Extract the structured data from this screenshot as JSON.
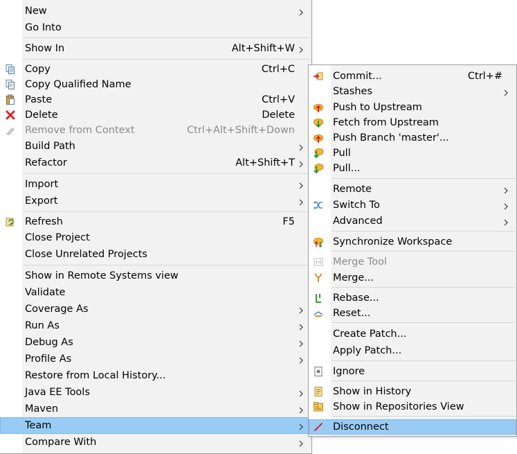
{
  "main_menu": {
    "items": [
      {
        "label": "New",
        "arrow": true
      },
      {
        "label": "Go Into"
      },
      {
        "label": "Show In",
        "shortcut": "Alt+Shift+W",
        "arrow": true
      },
      {
        "label": "Copy",
        "shortcut": "Ctrl+C",
        "icon": "copy-icon"
      },
      {
        "label": "Copy Qualified Name",
        "icon": "copy-qualified-name-icon"
      },
      {
        "label": "Paste",
        "shortcut": "Ctrl+V",
        "icon": "paste-icon"
      },
      {
        "label": "Delete",
        "shortcut": "Delete",
        "icon": "delete-icon"
      },
      {
        "label": "Remove from Context",
        "shortcut": "Ctrl+Alt+Shift+Down",
        "icon": "remove-from-context-icon",
        "disabled": true
      },
      {
        "label": "Build Path",
        "arrow": true
      },
      {
        "label": "Refactor",
        "shortcut": "Alt+Shift+T",
        "arrow": true
      },
      {
        "label": "Import",
        "arrow": true
      },
      {
        "label": "Export",
        "arrow": true
      },
      {
        "label": "Refresh",
        "shortcut": "F5",
        "icon": "refresh-icon"
      },
      {
        "label": "Close Project"
      },
      {
        "label": "Close Unrelated Projects"
      },
      {
        "label": "Show in Remote Systems view"
      },
      {
        "label": "Validate"
      },
      {
        "label": "Coverage As",
        "arrow": true
      },
      {
        "label": "Run As",
        "arrow": true
      },
      {
        "label": "Debug As",
        "arrow": true
      },
      {
        "label": "Profile As",
        "arrow": true
      },
      {
        "label": "Restore from Local History..."
      },
      {
        "label": "Java EE Tools",
        "arrow": true
      },
      {
        "label": "Maven",
        "arrow": true
      },
      {
        "label": "Team",
        "arrow": true,
        "highlighted": true
      },
      {
        "label": "Compare With",
        "arrow": true
      }
    ]
  },
  "team_menu": {
    "items": [
      {
        "label": "Commit...",
        "shortcut": "Ctrl+#",
        "icon": "commit-icon"
      },
      {
        "label": "Stashes",
        "arrow": true
      },
      {
        "label": "Push to Upstream",
        "icon": "push-upstream-icon"
      },
      {
        "label": "Fetch from Upstream",
        "icon": "fetch-upstream-icon"
      },
      {
        "label": "Push Branch 'master'...",
        "icon": "push-branch-icon"
      },
      {
        "label": "Pull",
        "icon": "pull-icon"
      },
      {
        "label": "Pull...",
        "icon": "pull-dialog-icon"
      },
      {
        "label": "Remote",
        "arrow": true
      },
      {
        "label": "Switch To",
        "arrow": true,
        "icon": "switch-branch-icon"
      },
      {
        "label": "Advanced",
        "arrow": true
      },
      {
        "label": "Synchronize Workspace",
        "icon": "synchronize-icon"
      },
      {
        "label": "Merge Tool",
        "icon": "merge-tool-icon",
        "disabled": true
      },
      {
        "label": "Merge...",
        "icon": "merge-icon"
      },
      {
        "label": "Rebase...",
        "icon": "rebase-icon"
      },
      {
        "label": "Reset...",
        "icon": "reset-icon"
      },
      {
        "label": "Create Patch..."
      },
      {
        "label": "Apply Patch..."
      },
      {
        "label": "Ignore",
        "icon": "ignore-icon"
      },
      {
        "label": "Show in History",
        "icon": "history-icon"
      },
      {
        "label": "Show in Repositories View",
        "icon": "repositories-icon"
      },
      {
        "label": "Disconnect",
        "icon": "disconnect-icon",
        "highlighted": true
      }
    ]
  },
  "colors": {
    "highlight": "#99ccf5",
    "menu_bg": "#f2f2f2",
    "disabled_text": "#8a8a8a",
    "separator": "#d7d7d7"
  }
}
